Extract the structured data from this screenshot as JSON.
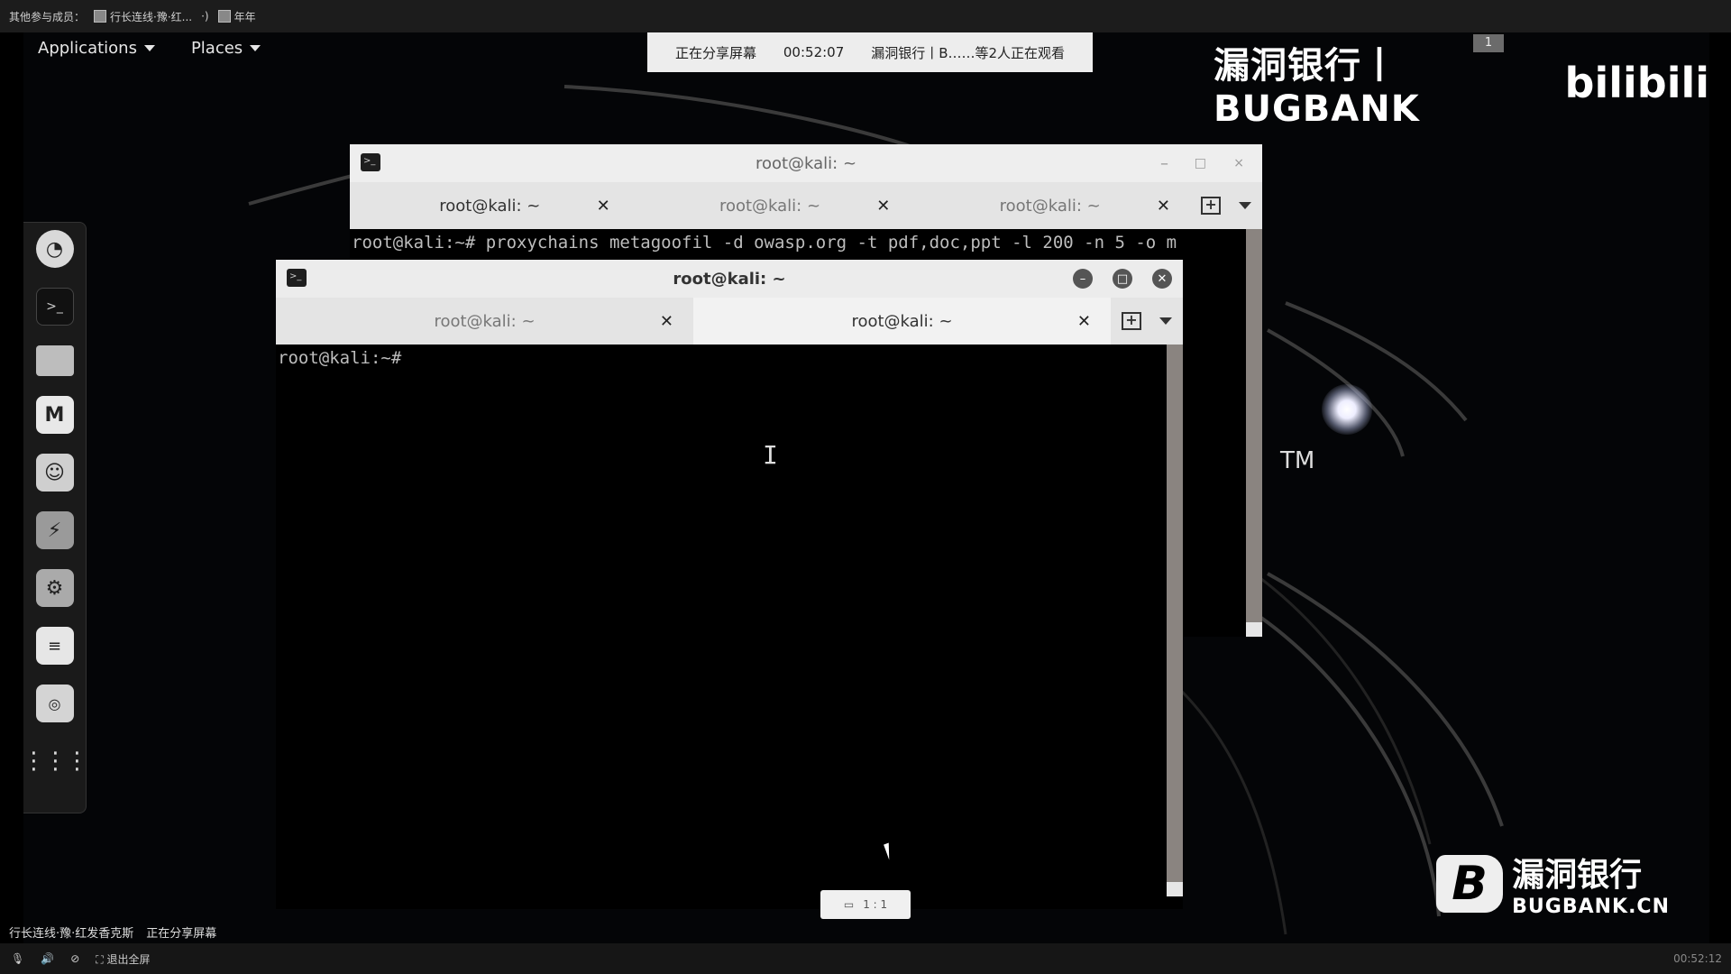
{
  "meeting_bar": {
    "participants_label": "其他参与成员：",
    "member_1": "行长连线·豫·红...",
    "member_2": "年年"
  },
  "gnome_panel": {
    "applications": "Applications",
    "places": "Places"
  },
  "share_banner": {
    "status": "正在分享屏幕",
    "timer": "00:52:07",
    "viewers": "漏洞银行丨B……等2人正在观看"
  },
  "watermark": {
    "top_text": "漏洞银行丨BUGBANK",
    "bilibili": "bilibili",
    "badge": "1",
    "bottom_logo_letter": "B",
    "bottom_cn": "漏洞银行",
    "bottom_en": "BUGBANK.CN",
    "tm": "TM"
  },
  "dock": {
    "items": [
      "firefox-icon",
      "terminal-icon",
      "files-icon",
      "metasploit-icon",
      "armitage-icon",
      "burpsuite-icon",
      "maltego-icon",
      "leafpad-icon",
      "cherrytree-icon",
      "show-apps-icon"
    ]
  },
  "term_back": {
    "title": "root@kali: ~",
    "tabs": [
      "root@kali: ~",
      "root@kali: ~",
      "root@kali: ~"
    ],
    "line": "root@kali:~# proxychains metagoofil -d owasp.org -t pdf,doc,ppt -l 200 -n 5 -o m"
  },
  "term_front": {
    "title": "root@kali: ~",
    "tabs": [
      "root@kali: ~",
      "root@kali: ~"
    ],
    "prompt": "root@kali:~#"
  },
  "ratio_button": "1 : 1",
  "status_line": {
    "left": "行长连线·豫·红发香克斯",
    "sharing": "正在分享屏幕"
  },
  "bottom_bar": {
    "exit_fullscreen": "退出全屏",
    "time": "00:52:12"
  }
}
